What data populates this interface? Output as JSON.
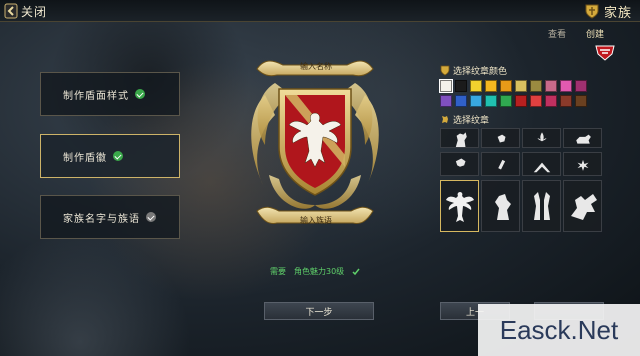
{
  "topbar": {
    "close_label": "关闭",
    "title": "家族"
  },
  "sub_tabs": [
    {
      "label": "查看",
      "active": false
    },
    {
      "label": "创建",
      "active": true
    }
  ],
  "steps": [
    {
      "label": "制作盾面样式",
      "status": "done",
      "active": false
    },
    {
      "label": "制作盾徽",
      "status": "done",
      "active": true
    },
    {
      "label": "家族名字与族语",
      "status": "todo",
      "active": false
    }
  ],
  "crest": {
    "name_scroll": "输入名称",
    "motto_scroll": "输入族语"
  },
  "requirement": {
    "label": "需要",
    "text": "角色魅力30级"
  },
  "buttons": {
    "next": "下一步",
    "prev": "上一"
  },
  "color_section": {
    "title": "选择纹章颜色",
    "swatches": [
      "#f4f2ea",
      "#1b1b1b",
      "#f2d22e",
      "#f4b820",
      "#e79a18",
      "#d8c060",
      "#9a8a40",
      "#c86a8a",
      "#e25ab0",
      "#a03070",
      "#8050c0",
      "#3060c8",
      "#38a8e0",
      "#20c0b0",
      "#30a850",
      "#b82020",
      "#e04040",
      "#c03060",
      "#8a3a2a",
      "#6a4020"
    ],
    "selected_index": 0
  },
  "emblem_section": {
    "title": "选择纹章",
    "icons": [
      "knight-horse-icon",
      "gauntlet-icon",
      "fleur-de-lis-icon",
      "lion-passant-icon",
      "dragon-head-icon",
      "feather-icon",
      "chevron-icon",
      "maltese-cross-icon",
      "eagle-icon",
      "lion-rampant-icon",
      "twin-seahorse-icon",
      "dragon-icon"
    ],
    "selected_index": 8
  },
  "watermark": "Easck.Net",
  "colors": {
    "accent_gold": "#cdb368",
    "check_green": "#3aa84a",
    "crest_red": "#b0161c"
  }
}
